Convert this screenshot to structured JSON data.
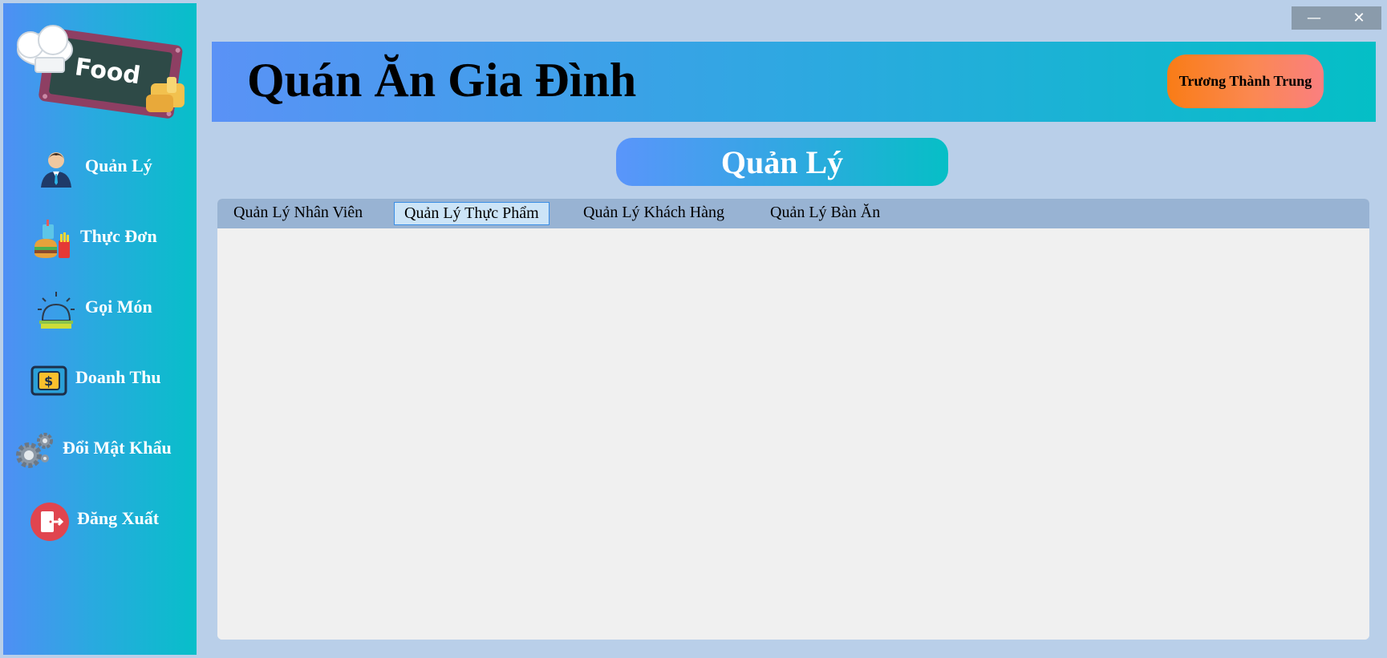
{
  "window": {
    "minimize_symbol": "—",
    "close_symbol": "✕"
  },
  "sidebar": {
    "logo_text": "Food",
    "items": [
      {
        "label": "Quản Lý",
        "icon": "manager-icon"
      },
      {
        "label": "Thực Đơn",
        "icon": "food-menu-icon"
      },
      {
        "label": "Gọi Món",
        "icon": "service-bell-icon"
      },
      {
        "label": "Doanh Thu",
        "icon": "money-icon"
      },
      {
        "label": "Đổi Mật Khẩu",
        "icon": "gears-icon"
      },
      {
        "label": "Đăng Xuất",
        "icon": "logout-icon"
      }
    ]
  },
  "header": {
    "title": "Quán Ăn Gia Đình",
    "user_name": "Trương Thành Trung"
  },
  "section": {
    "title": "Quản Lý"
  },
  "tabs": [
    {
      "label": "Quản Lý Nhân Viên",
      "active": false
    },
    {
      "label": "Quản Lý Thực Phẩm",
      "active": true
    },
    {
      "label": "Quản Lý Khách Hàng",
      "active": false
    },
    {
      "label": "Quản Lý Bàn Ăn",
      "active": false
    }
  ],
  "colors": {
    "window_bg": "#b9cfe9",
    "gradient_start": "#4f8ff5",
    "gradient_end": "#04bfc6",
    "user_badge": "#f97c16",
    "tab_strip": "#98b3d3",
    "active_tab": "#cce4f7"
  }
}
